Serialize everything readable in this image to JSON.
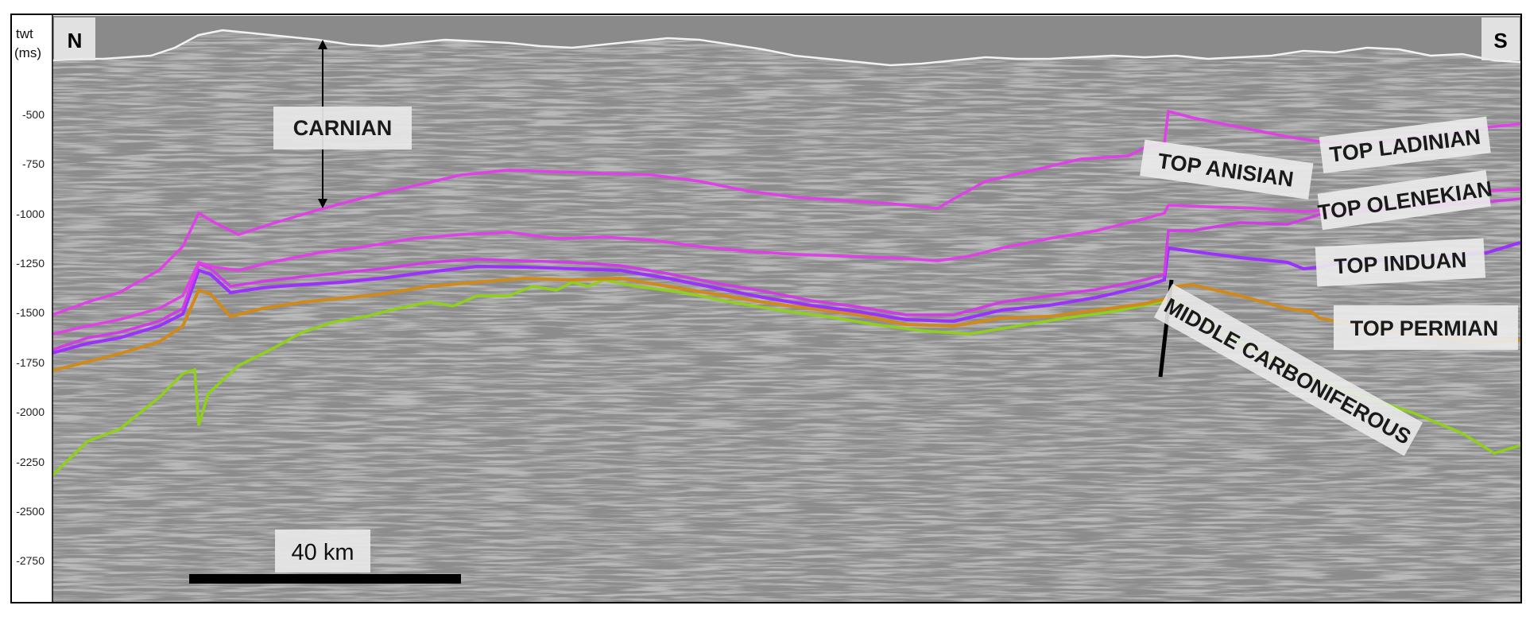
{
  "axis": {
    "title_line1": "twt",
    "title_line2": "(ms)",
    "ticks": [
      "-500",
      "-750",
      "-1000",
      "-1250",
      "-1500",
      "-1750",
      "-2000",
      "-2250",
      "-2500",
      "-2750"
    ]
  },
  "compass": {
    "left": "N",
    "right": "S"
  },
  "interval_label": "CARNIAN",
  "horizons": [
    {
      "label": "TOP LADINIAN",
      "color": "#e040e8"
    },
    {
      "label": "TOP ANISIAN",
      "color": "#e040e8"
    },
    {
      "label": "TOP OLENEKIAN",
      "color": "#d23ce6"
    },
    {
      "label": "TOP INDUAN",
      "color": "#9b30ff"
    },
    {
      "label": "TOP PERMIAN",
      "color": "#d08a1c"
    },
    {
      "label": "MIDDLE CARBONIFEROUS",
      "color": "#8fd01a"
    }
  ],
  "scale_bar": {
    "label": "40 km"
  }
}
